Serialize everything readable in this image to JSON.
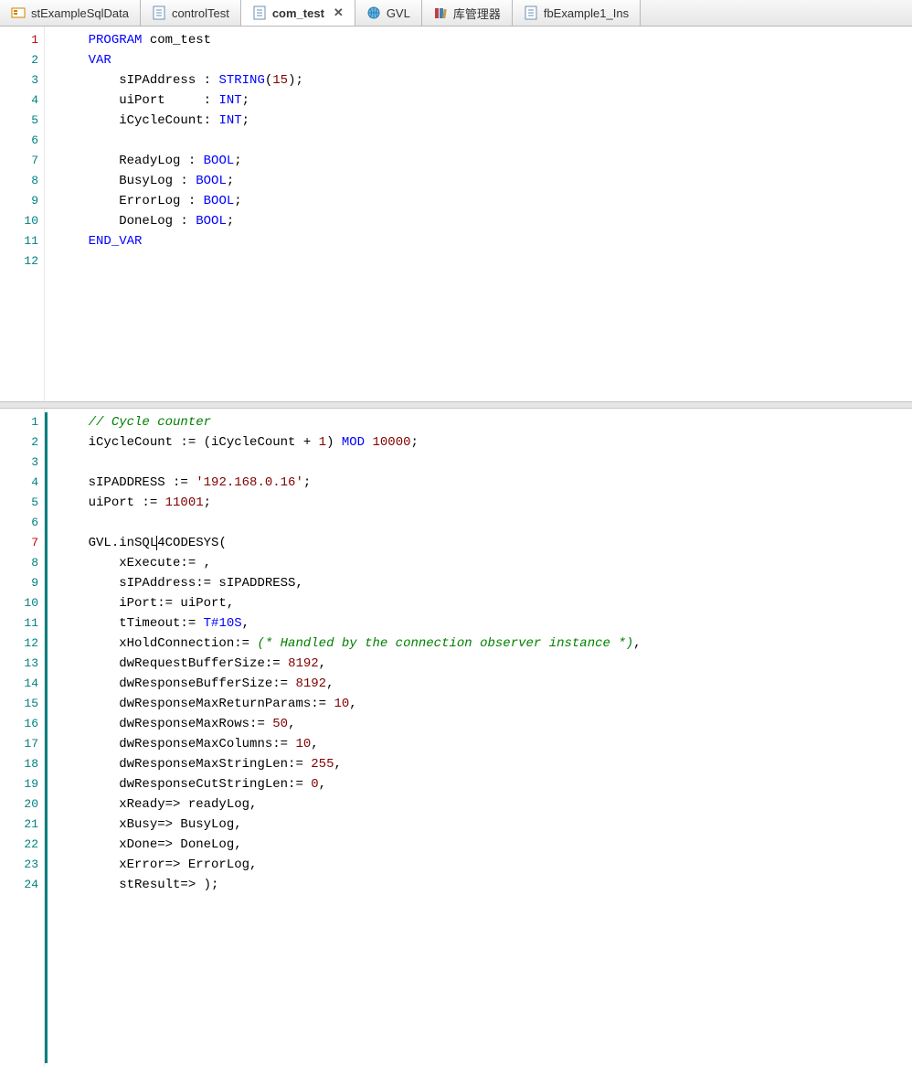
{
  "tabs": [
    {
      "label": "stExampleSqlData",
      "icon": "struct"
    },
    {
      "label": "controlTest",
      "icon": "pou"
    },
    {
      "label": "com_test",
      "icon": "pou",
      "active": true,
      "close": "✕"
    },
    {
      "label": "GVL",
      "icon": "globe"
    },
    {
      "label": "库管理器",
      "icon": "library"
    },
    {
      "label": "fbExample1_Ins",
      "icon": "pou"
    }
  ],
  "pane1": {
    "lines": [
      {
        "n": "1",
        "mod": true,
        "t": [
          [
            "i",
            "    "
          ],
          [
            "kw",
            "PROGRAM"
          ],
          [
            "p",
            " com_test"
          ]
        ]
      },
      {
        "n": "2",
        "t": [
          [
            "i",
            "    "
          ],
          [
            "kw",
            "VAR"
          ]
        ]
      },
      {
        "n": "3",
        "t": [
          [
            "i",
            "        "
          ],
          [
            "p",
            "sIPAddress : "
          ],
          [
            "ty",
            "STRING"
          ],
          [
            "p",
            "("
          ],
          [
            "nm",
            "15"
          ],
          [
            "p",
            ");"
          ]
        ]
      },
      {
        "n": "4",
        "t": [
          [
            "i",
            "        "
          ],
          [
            "p",
            "uiPort     : "
          ],
          [
            "ty",
            "INT"
          ],
          [
            "p",
            ";"
          ]
        ]
      },
      {
        "n": "5",
        "t": [
          [
            "i",
            "        "
          ],
          [
            "p",
            "iCycleCount: "
          ],
          [
            "ty",
            "INT"
          ],
          [
            "p",
            ";"
          ]
        ]
      },
      {
        "n": "6",
        "t": []
      },
      {
        "n": "7",
        "t": [
          [
            "i",
            "        "
          ],
          [
            "p",
            "ReadyLog : "
          ],
          [
            "ty",
            "BOOL"
          ],
          [
            "p",
            ";"
          ]
        ]
      },
      {
        "n": "8",
        "t": [
          [
            "i",
            "        "
          ],
          [
            "p",
            "BusyLog : "
          ],
          [
            "ty",
            "BOOL"
          ],
          [
            "p",
            ";"
          ]
        ]
      },
      {
        "n": "9",
        "t": [
          [
            "i",
            "        "
          ],
          [
            "p",
            "ErrorLog : "
          ],
          [
            "ty",
            "BOOL"
          ],
          [
            "p",
            ";"
          ]
        ]
      },
      {
        "n": "10",
        "t": [
          [
            "i",
            "        "
          ],
          [
            "p",
            "DoneLog : "
          ],
          [
            "ty",
            "BOOL"
          ],
          [
            "p",
            ";"
          ]
        ]
      },
      {
        "n": "11",
        "t": [
          [
            "i",
            "    "
          ],
          [
            "kw",
            "END_VAR"
          ]
        ]
      },
      {
        "n": "12",
        "t": []
      }
    ]
  },
  "pane2": {
    "highlight": 7,
    "lines": [
      {
        "n": "1",
        "t": [
          [
            "i",
            "    "
          ],
          [
            "cm",
            "// Cycle counter"
          ]
        ]
      },
      {
        "n": "2",
        "t": [
          [
            "i",
            "    "
          ],
          [
            "p",
            "iCycleCount := (iCycleCount + "
          ],
          [
            "nm",
            "1"
          ],
          [
            "p",
            ") "
          ],
          [
            "kw",
            "MOD"
          ],
          [
            "p",
            " "
          ],
          [
            "nm",
            "10000"
          ],
          [
            "p",
            ";"
          ]
        ]
      },
      {
        "n": "3",
        "t": []
      },
      {
        "n": "4",
        "t": [
          [
            "i",
            "    "
          ],
          [
            "p",
            "sIPADDRESS := "
          ],
          [
            "st",
            "'192.168.0.16'"
          ],
          [
            "p",
            ";"
          ]
        ]
      },
      {
        "n": "5",
        "t": [
          [
            "i",
            "    "
          ],
          [
            "p",
            "uiPort := "
          ],
          [
            "nm",
            "11001"
          ],
          [
            "p",
            ";"
          ]
        ]
      },
      {
        "n": "6",
        "t": []
      },
      {
        "n": "7",
        "mod": true,
        "t": [
          [
            "i",
            "    "
          ],
          [
            "p",
            "GVL.inSQL"
          ],
          [
            "caret",
            ""
          ],
          [
            "p",
            "4CODESYS("
          ]
        ]
      },
      {
        "n": "8",
        "t": [
          [
            "i",
            "        "
          ],
          [
            "p",
            "xExecute:= ,"
          ]
        ]
      },
      {
        "n": "9",
        "t": [
          [
            "i",
            "        "
          ],
          [
            "p",
            "sIPAddress:= sIPADDRESS,"
          ]
        ]
      },
      {
        "n": "10",
        "t": [
          [
            "i",
            "        "
          ],
          [
            "p",
            "iPort:= uiPort,"
          ]
        ]
      },
      {
        "n": "11",
        "t": [
          [
            "i",
            "        "
          ],
          [
            "p",
            "tTimeout:= "
          ],
          [
            "ty",
            "T#10S"
          ],
          [
            "p",
            ","
          ]
        ]
      },
      {
        "n": "12",
        "t": [
          [
            "i",
            "        "
          ],
          [
            "p",
            "xHoldConnection:= "
          ],
          [
            "cm",
            "(* Handled by the connection observer instance *)"
          ],
          [
            "p",
            ","
          ]
        ]
      },
      {
        "n": "13",
        "t": [
          [
            "i",
            "        "
          ],
          [
            "p",
            "dwRequestBufferSize:= "
          ],
          [
            "nm",
            "8192"
          ],
          [
            "p",
            ","
          ]
        ]
      },
      {
        "n": "14",
        "t": [
          [
            "i",
            "        "
          ],
          [
            "p",
            "dwResponseBufferSize:= "
          ],
          [
            "nm",
            "8192"
          ],
          [
            "p",
            ","
          ]
        ]
      },
      {
        "n": "15",
        "t": [
          [
            "i",
            "        "
          ],
          [
            "p",
            "dwResponseMaxReturnParams:= "
          ],
          [
            "nm",
            "10"
          ],
          [
            "p",
            ","
          ]
        ]
      },
      {
        "n": "16",
        "t": [
          [
            "i",
            "        "
          ],
          [
            "p",
            "dwResponseMaxRows:= "
          ],
          [
            "nm",
            "50"
          ],
          [
            "p",
            ","
          ]
        ]
      },
      {
        "n": "17",
        "t": [
          [
            "i",
            "        "
          ],
          [
            "p",
            "dwResponseMaxColumns:= "
          ],
          [
            "nm",
            "10"
          ],
          [
            "p",
            ","
          ]
        ]
      },
      {
        "n": "18",
        "t": [
          [
            "i",
            "        "
          ],
          [
            "p",
            "dwResponseMaxStringLen:= "
          ],
          [
            "nm",
            "255"
          ],
          [
            "p",
            ","
          ]
        ]
      },
      {
        "n": "19",
        "t": [
          [
            "i",
            "        "
          ],
          [
            "p",
            "dwResponseCutStringLen:= "
          ],
          [
            "nm",
            "0"
          ],
          [
            "p",
            ","
          ]
        ]
      },
      {
        "n": "20",
        "t": [
          [
            "i",
            "        "
          ],
          [
            "p",
            "xReady=> readyLog,"
          ]
        ]
      },
      {
        "n": "21",
        "t": [
          [
            "i",
            "        "
          ],
          [
            "p",
            "xBusy=> BusyLog,"
          ]
        ]
      },
      {
        "n": "22",
        "t": [
          [
            "i",
            "        "
          ],
          [
            "p",
            "xDone=> DoneLog,"
          ]
        ]
      },
      {
        "n": "23",
        "t": [
          [
            "i",
            "        "
          ],
          [
            "p",
            "xError=> ErrorLog,"
          ]
        ]
      },
      {
        "n": "24",
        "t": [
          [
            "i",
            "        "
          ],
          [
            "p",
            "stResult=> );"
          ]
        ]
      }
    ]
  }
}
